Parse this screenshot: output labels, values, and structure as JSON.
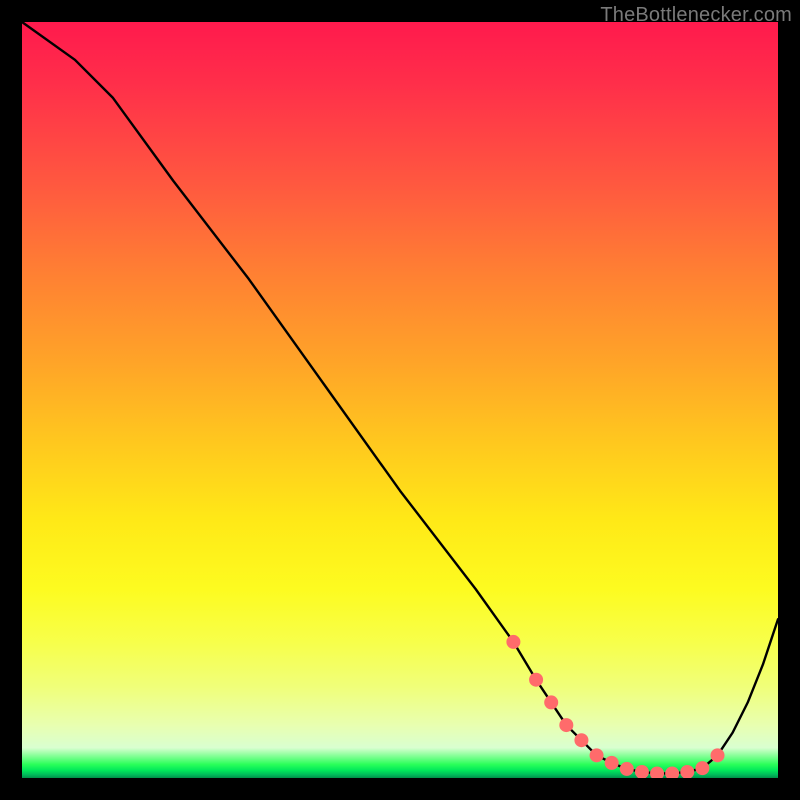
{
  "watermark": "TheBottlenecker.com",
  "chart_data": {
    "type": "line",
    "title": "",
    "xlabel": "",
    "ylabel": "",
    "xlim": [
      0,
      100
    ],
    "ylim": [
      0,
      100
    ],
    "background_gradient": [
      "#ff1a4d",
      "#ffa428",
      "#fdfb20",
      "#00b85a"
    ],
    "series": [
      {
        "name": "bottleneck-curve",
        "x": [
          0,
          7,
          12,
          20,
          30,
          40,
          50,
          60,
          65,
          68,
          70,
          72,
          74,
          76,
          78,
          80,
          82,
          84,
          86,
          88,
          90,
          92,
          94,
          96,
          98,
          100
        ],
        "values": [
          100,
          95,
          90,
          79,
          66,
          52,
          38,
          25,
          18,
          13,
          10,
          7,
          5,
          3,
          2,
          1.2,
          0.8,
          0.6,
          0.6,
          0.8,
          1.3,
          3,
          6,
          10,
          15,
          21
        ]
      }
    ],
    "markers": {
      "name": "highlight-dots",
      "x": [
        65,
        68,
        70,
        72,
        74,
        76,
        78,
        80,
        82,
        84,
        86,
        88,
        90,
        92
      ],
      "values": [
        18,
        13,
        10,
        7,
        5,
        3,
        2,
        1.2,
        0.8,
        0.6,
        0.6,
        0.8,
        1.3,
        3
      ],
      "color": "#ff6b6b",
      "radius": 7
    }
  }
}
